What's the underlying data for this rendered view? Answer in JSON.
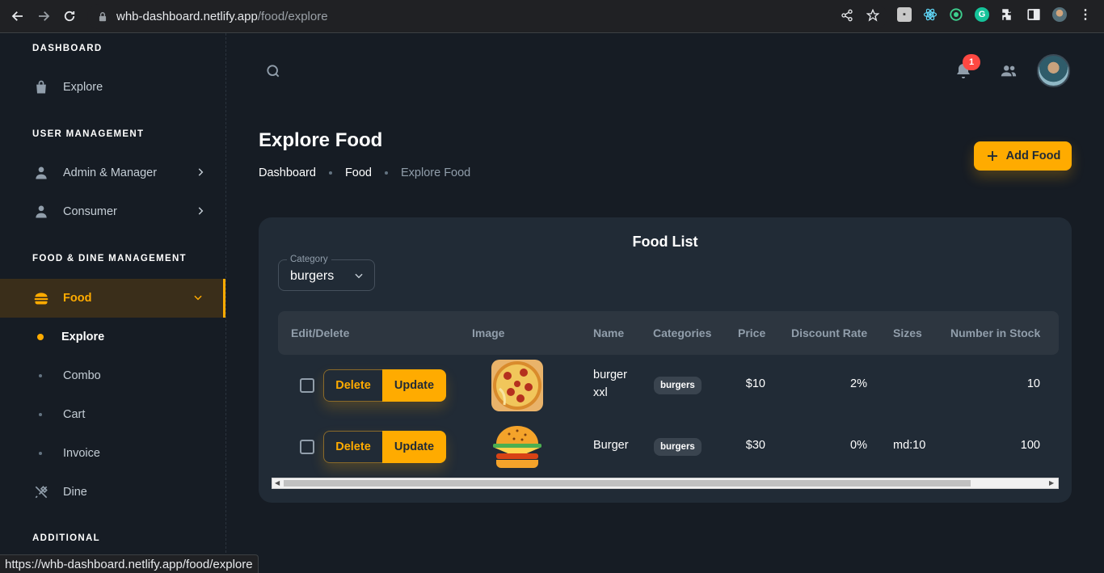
{
  "browser": {
    "url_host": "whb-dashboard.netlify.app",
    "url_path": "/food/explore",
    "status_url": "https://whb-dashboard.netlify.app/food/explore"
  },
  "sidebar": {
    "sections": [
      {
        "title": "DASHBOARD"
      },
      {
        "title": "USER MANAGEMENT"
      },
      {
        "title": "FOOD & DINE MANAGEMENT"
      },
      {
        "title": "ADDITIONAL"
      }
    ],
    "items": [
      {
        "label": "Explore",
        "icon": "shopping-bag-icon"
      },
      {
        "label": "Admin & Manager",
        "icon": "user-icon"
      },
      {
        "label": "Consumer",
        "icon": "user-icon"
      },
      {
        "label": "Food",
        "icon": "burger-icon",
        "active": true
      },
      {
        "label": "Dine",
        "icon": "utensils-icon"
      }
    ],
    "food_sub": [
      {
        "label": "Explore",
        "active": true
      },
      {
        "label": "Combo"
      },
      {
        "label": "Cart"
      },
      {
        "label": "Invoice"
      }
    ]
  },
  "header": {
    "notification_count": "1"
  },
  "page": {
    "title": "Explore Food",
    "breadcrumb": [
      "Dashboard",
      "Food",
      "Explore Food"
    ],
    "add_button": "Add Food"
  },
  "card": {
    "title": "Food List",
    "category_label": "Category",
    "category_value": "burgers"
  },
  "table": {
    "columns": [
      "Edit/Delete",
      "Image",
      "Name",
      "Categories",
      "Price",
      "Discount Rate",
      "Sizes",
      "Number in Stock"
    ],
    "delete_label": "Delete",
    "update_label": "Update",
    "rows": [
      {
        "name_line1": "burger",
        "name_line2": "xxl",
        "category": "burgers",
        "price": "$10",
        "discount": "2%",
        "sizes": "",
        "stock": "10",
        "image": "pizza"
      },
      {
        "name_line1": "Burger",
        "name_line2": "",
        "category": "burgers",
        "price": "$30",
        "discount": "0%",
        "sizes": "md:10",
        "stock": "100",
        "image": "burger"
      }
    ]
  },
  "colors": {
    "accent": "#ffab00",
    "background": "#161c24",
    "card": "#212b36",
    "badge": "#ff4842"
  }
}
